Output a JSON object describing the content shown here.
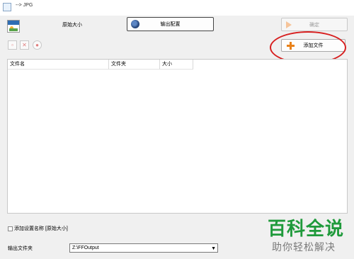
{
  "window": {
    "title": "--> JPG"
  },
  "format": {
    "icon": "jpg-image-icon",
    "size_label": "原始大小"
  },
  "buttons": {
    "output_settings": "输出配置",
    "ok": "确定",
    "add_files": "添加文件"
  },
  "toolbar": {
    "icons": [
      "add-page-icon",
      "delete-icon",
      "clear-icon"
    ]
  },
  "file_list": {
    "columns": [
      "文件名",
      "文件夹",
      "大小"
    ],
    "rows": []
  },
  "options": {
    "add_setting_name_label": "添加设置名称 [原始大小]",
    "add_setting_name_checked": false
  },
  "output": {
    "label": "输出文件夹",
    "folder": "Z:\\FFOutput"
  },
  "annotation": {
    "color": "#d71f1f"
  },
  "watermark": {
    "line1": "百科全说",
    "line2": "助你轻松解决"
  }
}
